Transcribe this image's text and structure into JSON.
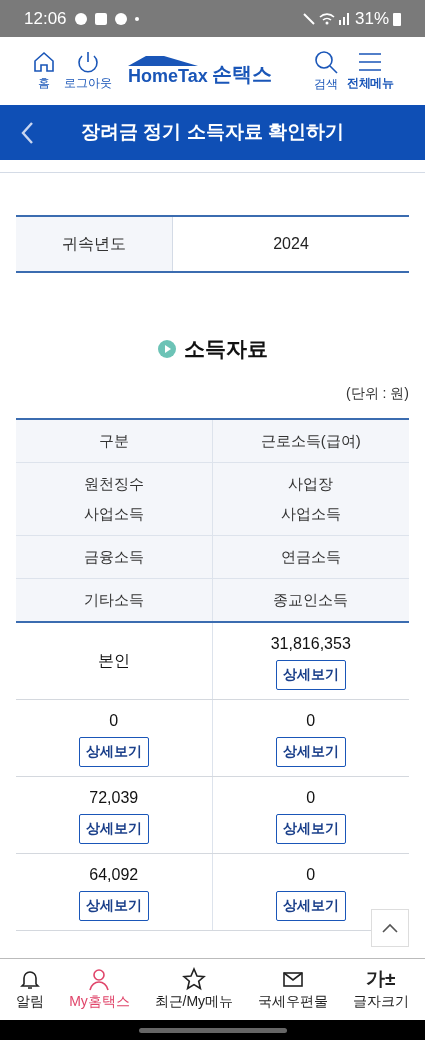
{
  "status_bar": {
    "time": "12:06",
    "battery": "31%"
  },
  "header": {
    "home": "홈",
    "logout": "로그아웃",
    "logo": "HomeTax",
    "logo_korean": "손택스",
    "search": "검색",
    "menu": "전체메뉴"
  },
  "title_bar": {
    "title": "장려금 정기 소득자료 확인하기"
  },
  "year_table": {
    "label": "귀속년도",
    "value": "2024"
  },
  "section": {
    "title": "소득자료",
    "unit": "(단위 : 원)"
  },
  "income_table": {
    "header_rows": [
      [
        "구분",
        "근로소득(급여)"
      ],
      [
        "원천징수\n사업소득",
        "사업장\n사업소득"
      ],
      [
        "금융소득",
        "연금소득"
      ],
      [
        "기타소득",
        "종교인소득"
      ]
    ],
    "rows": [
      [
        {
          "value": "본인"
        },
        {
          "value": "31,816,353",
          "button": "상세보기"
        }
      ],
      [
        {
          "value": "0",
          "button": "상세보기"
        },
        {
          "value": "0",
          "button": "상세보기"
        }
      ],
      [
        {
          "value": "72,039",
          "button": "상세보기"
        },
        {
          "value": "0",
          "button": "상세보기"
        }
      ],
      [
        {
          "value": "64,092",
          "button": "상세보기"
        },
        {
          "value": "0",
          "button": "상세보기"
        }
      ]
    ]
  },
  "bottom_nav": [
    {
      "kind": "bell",
      "label": "알림",
      "selected": false
    },
    {
      "kind": "person",
      "label": "My홈택스",
      "selected": true
    },
    {
      "kind": "star",
      "label": "최근/My메뉴",
      "selected": false
    },
    {
      "kind": "mail",
      "label": "국세우편물",
      "selected": false
    },
    {
      "kind": "text",
      "icon_text": "가±",
      "label": "글자크기",
      "selected": false
    }
  ]
}
